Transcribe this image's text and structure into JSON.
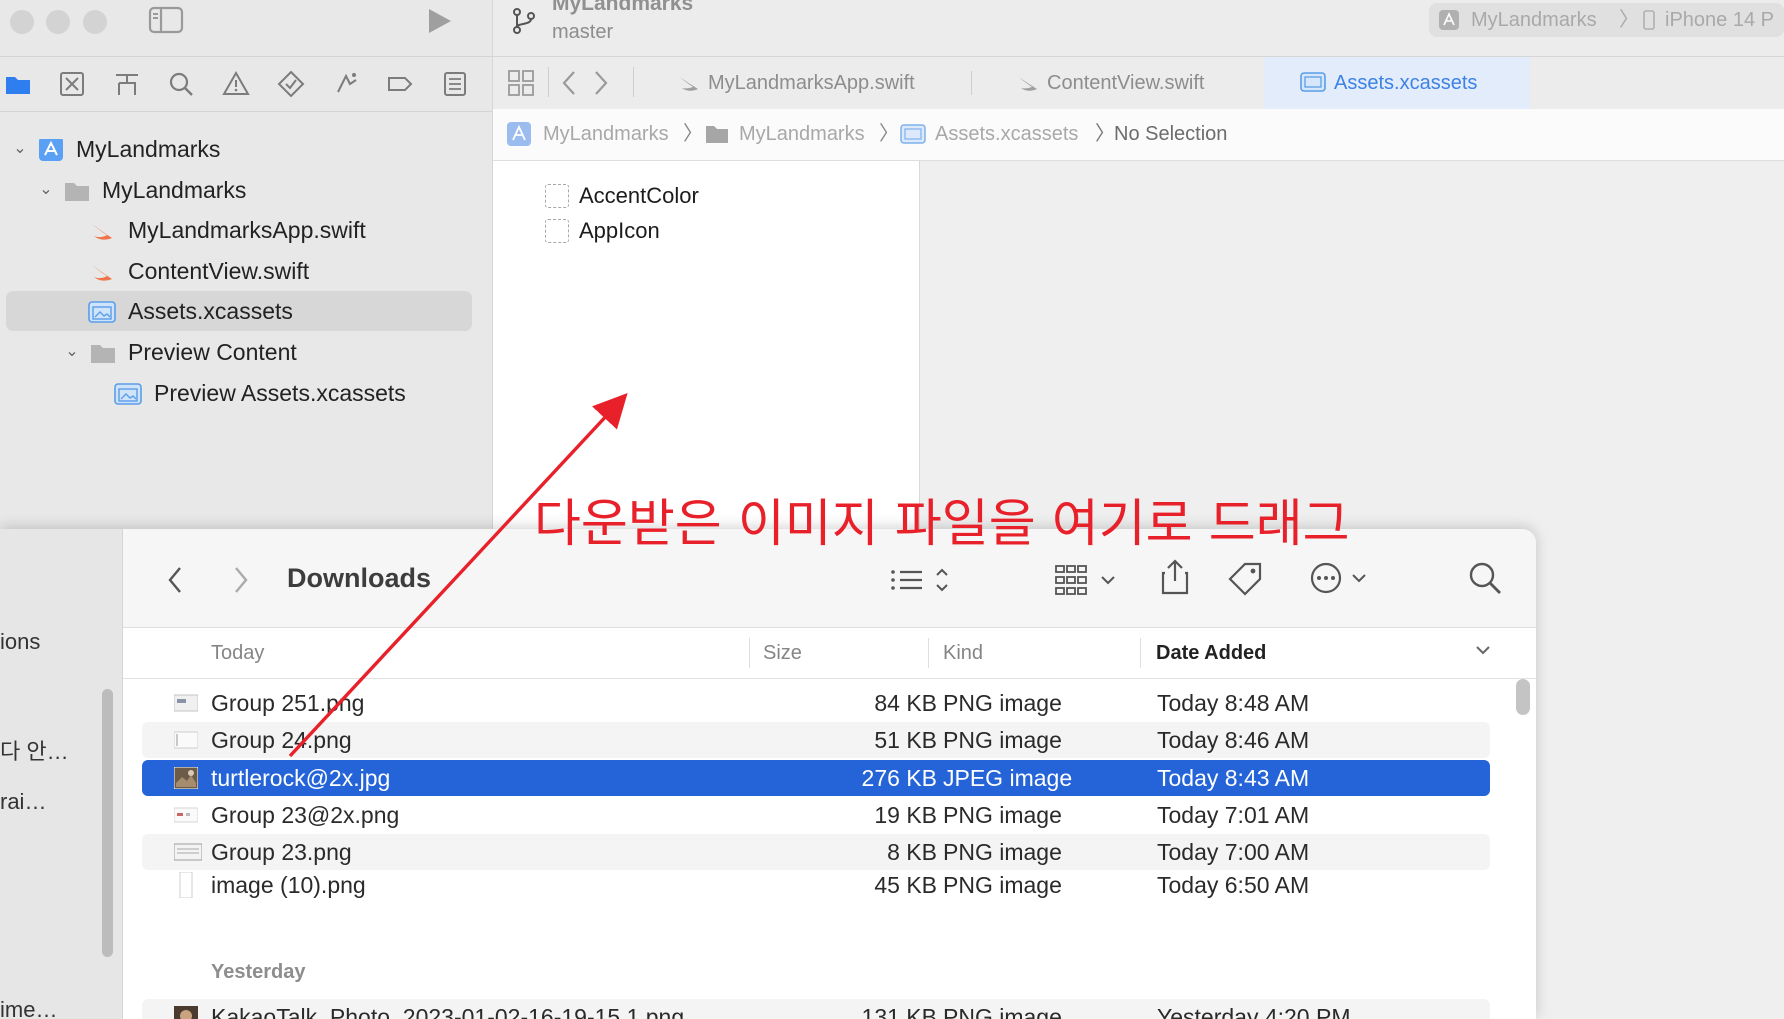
{
  "xcode": {
    "project_title": "MyLandmarks",
    "branch": "master",
    "scheme": {
      "project": "MyLandmarks",
      "device": "iPhone 14 P"
    },
    "tabs": [
      {
        "label": "MyLandmarksApp.swift",
        "active": false
      },
      {
        "label": "ContentView.swift",
        "active": false
      },
      {
        "label": "Assets.xcassets",
        "active": true
      }
    ],
    "jumpbar": {
      "project": "MyLandmarks",
      "group": "MyLandmarks",
      "file": "Assets.xcassets",
      "selection": "No Selection"
    },
    "navigator": [
      {
        "label": "MyLandmarks",
        "icon": "project-icon",
        "level": 0,
        "expanded": true
      },
      {
        "label": "MyLandmarks",
        "icon": "folder-icon",
        "level": 1,
        "expanded": true
      },
      {
        "label": "MyLandmarksApp.swift",
        "icon": "swift-file-icon",
        "level": 2
      },
      {
        "label": "ContentView.swift",
        "icon": "swift-file-icon",
        "level": 2
      },
      {
        "label": "Assets.xcassets",
        "icon": "asset-catalog-icon",
        "level": 2,
        "selected": true
      },
      {
        "label": "Preview Content",
        "icon": "folder-icon",
        "level": 2,
        "expanded": true
      },
      {
        "label": "Preview Assets.xcassets",
        "icon": "asset-catalog-icon",
        "level": 3
      }
    ],
    "assets": [
      "AccentColor",
      "AppIcon"
    ]
  },
  "annotation": {
    "text": "다운받은 이미지 파일을 여기로 드래그",
    "color": "#e8202a"
  },
  "finder": {
    "title": "Downloads",
    "sidebar_items": [
      "ions",
      "다 안…",
      "rai…",
      "ime…"
    ],
    "columns": {
      "name": "Today",
      "size": "Size",
      "kind": "Kind",
      "date": "Date Added"
    },
    "groups": {
      "today": "Today",
      "yesterday": "Yesterday"
    },
    "files": [
      {
        "name": "Group 251.png",
        "size": "84 KB",
        "kind": "PNG image",
        "date": "Today 8:48 AM"
      },
      {
        "name": "Group 24.png",
        "size": "51 KB",
        "kind": "PNG image",
        "date": "Today 8:46 AM"
      },
      {
        "name": "turtlerock@2x.jpg",
        "size": "276 KB",
        "kind": "JPEG image",
        "date": "Today 8:43 AM",
        "selected": true
      },
      {
        "name": "Group 23@2x.png",
        "size": "19 KB",
        "kind": "PNG image",
        "date": "Today 7:01 AM"
      },
      {
        "name": "Group 23.png",
        "size": "8 KB",
        "kind": "PNG image",
        "date": "Today 7:00 AM"
      },
      {
        "name": "image (10).png",
        "size": "45 KB",
        "kind": "PNG image",
        "date": "Today 6:50 AM"
      }
    ],
    "yesterday_files": [
      {
        "name": "KakaoTalk_Photo_2023-01-02-16-19-15 1.png",
        "size": "131 KB",
        "kind": "PNG image",
        "date": "Yesterday 4:20 PM"
      }
    ],
    "selection_color": "#2464d8"
  }
}
